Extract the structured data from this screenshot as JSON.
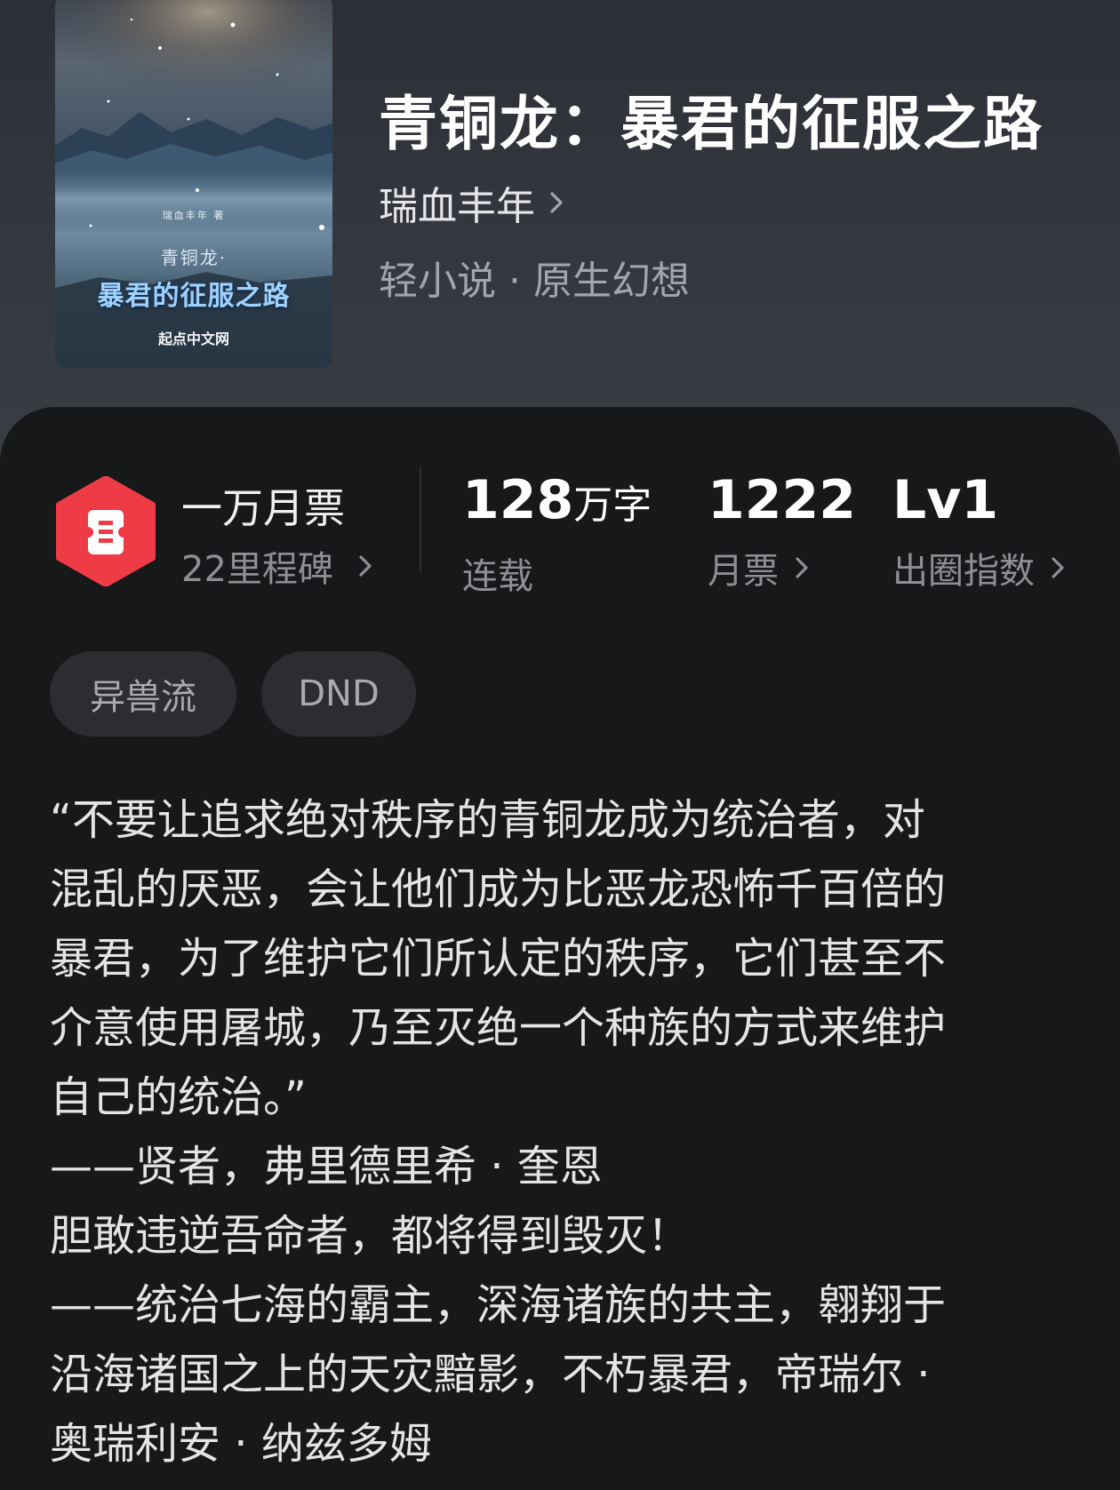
{
  "book": {
    "title": "青铜龙：暴君的征服之路",
    "author": "瑞血丰年",
    "genre": "轻小说 · 原生幻想"
  },
  "cover": {
    "author_line": "瑞血丰年 著",
    "subtitle": "青铜龙·",
    "title": "暴君的征服之路",
    "publisher": "起点中文网"
  },
  "stats": {
    "monthly_ticket_milestone": {
      "title": "一万月票",
      "subtitle": "22里程碑"
    },
    "word_count": {
      "value": "128",
      "unit": "万字",
      "label": "连载"
    },
    "monthly_tickets": {
      "value": "1222",
      "label": "月票"
    },
    "breakout_index": {
      "value": "Lv1",
      "label": "出圈指数"
    }
  },
  "tags": [
    "异兽流",
    "DND"
  ],
  "description_lines": [
    "“不要让追求绝对秩序的青铜龙成为统治者，对",
    "混乱的厌恶，会让他们成为比恶龙恐怖千百倍的",
    "暴君，为了维护它们所认定的秩序，它们甚至不",
    "介意使用屠城，乃至灭绝一个种族的方式来维护",
    "自己的统治。”",
    "——贤者，弗里德里希 · 奎恩",
    "胆敢违逆吾命者，都将得到毁灭！",
    "——统治七海的霸主，深海诸族的共主，翱翔于",
    "沿海诸国之上的天灾黯影，不朽暴君，帝瑞尔 ·",
    "奥瑞利安 · 纳兹多姆"
  ],
  "colors": {
    "badge_red": "#ee3b45",
    "background": "#17181a",
    "header_background": "#33363d"
  }
}
